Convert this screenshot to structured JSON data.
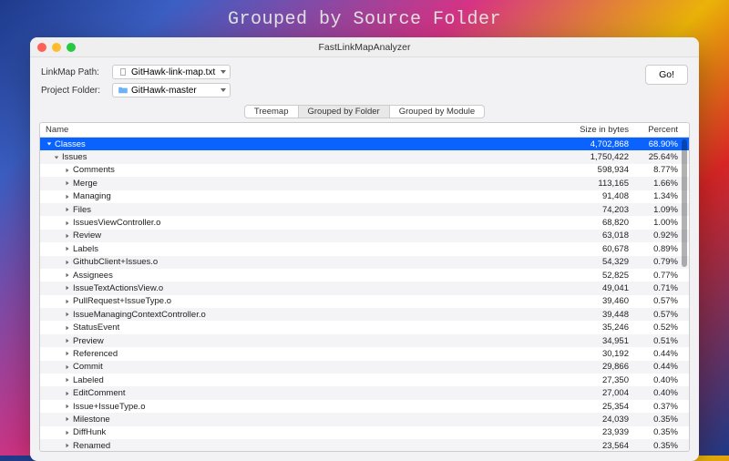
{
  "page_heading": "Grouped by Source Folder",
  "window": {
    "title": "FastLinkMapAnalyzer"
  },
  "toolbar": {
    "linkmap_label": "LinkMap Path:",
    "linkmap_value": "GitHawk-link-map.txt",
    "project_label": "Project Folder:",
    "project_value": "GitHawk-master",
    "go_label": "Go!"
  },
  "tabs": {
    "treemap": "Treemap",
    "folder": "Grouped by Folder",
    "module": "Grouped by Module"
  },
  "table": {
    "headers": {
      "name": "Name",
      "size": "Size in bytes",
      "percent": "Percent"
    },
    "rows": [
      {
        "name": "Classes",
        "size": "4,702,868",
        "percent": "68.90%",
        "indent": 0,
        "expanded": true,
        "selected": true
      },
      {
        "name": "Issues",
        "size": "1,750,422",
        "percent": "25.64%",
        "indent": 1,
        "expanded": true,
        "selected": false
      },
      {
        "name": "Comments",
        "size": "598,934",
        "percent": "8.77%",
        "indent": 2,
        "expanded": false,
        "selected": false
      },
      {
        "name": "Merge",
        "size": "113,165",
        "percent": "1.66%",
        "indent": 2,
        "expanded": false,
        "selected": false
      },
      {
        "name": "Managing",
        "size": "91,408",
        "percent": "1.34%",
        "indent": 2,
        "expanded": false,
        "selected": false
      },
      {
        "name": "Files",
        "size": "74,203",
        "percent": "1.09%",
        "indent": 2,
        "expanded": false,
        "selected": false
      },
      {
        "name": "IssuesViewController.o",
        "size": "68,820",
        "percent": "1.00%",
        "indent": 2,
        "expanded": false,
        "selected": false
      },
      {
        "name": "Review",
        "size": "63,018",
        "percent": "0.92%",
        "indent": 2,
        "expanded": false,
        "selected": false
      },
      {
        "name": "Labels",
        "size": "60,678",
        "percent": "0.89%",
        "indent": 2,
        "expanded": false,
        "selected": false
      },
      {
        "name": "GithubClient+Issues.o",
        "size": "54,329",
        "percent": "0.79%",
        "indent": 2,
        "expanded": false,
        "selected": false
      },
      {
        "name": "Assignees",
        "size": "52,825",
        "percent": "0.77%",
        "indent": 2,
        "expanded": false,
        "selected": false
      },
      {
        "name": "IssueTextActionsView.o",
        "size": "49,041",
        "percent": "0.71%",
        "indent": 2,
        "expanded": false,
        "selected": false
      },
      {
        "name": "PullRequest+IssueType.o",
        "size": "39,460",
        "percent": "0.57%",
        "indent": 2,
        "expanded": false,
        "selected": false
      },
      {
        "name": "IssueManagingContextController.o",
        "size": "39,448",
        "percent": "0.57%",
        "indent": 2,
        "expanded": false,
        "selected": false
      },
      {
        "name": "StatusEvent",
        "size": "35,246",
        "percent": "0.52%",
        "indent": 2,
        "expanded": false,
        "selected": false
      },
      {
        "name": "Preview",
        "size": "34,951",
        "percent": "0.51%",
        "indent": 2,
        "expanded": false,
        "selected": false
      },
      {
        "name": "Referenced",
        "size": "30,192",
        "percent": "0.44%",
        "indent": 2,
        "expanded": false,
        "selected": false
      },
      {
        "name": "Commit",
        "size": "29,866",
        "percent": "0.44%",
        "indent": 2,
        "expanded": false,
        "selected": false
      },
      {
        "name": "Labeled",
        "size": "27,350",
        "percent": "0.40%",
        "indent": 2,
        "expanded": false,
        "selected": false
      },
      {
        "name": "EditComment",
        "size": "27,004",
        "percent": "0.40%",
        "indent": 2,
        "expanded": false,
        "selected": false
      },
      {
        "name": "Issue+IssueType.o",
        "size": "25,354",
        "percent": "0.37%",
        "indent": 2,
        "expanded": false,
        "selected": false
      },
      {
        "name": "Milestone",
        "size": "24,039",
        "percent": "0.35%",
        "indent": 2,
        "expanded": false,
        "selected": false
      },
      {
        "name": "DiffHunk",
        "size": "23,939",
        "percent": "0.35%",
        "indent": 2,
        "expanded": false,
        "selected": false
      },
      {
        "name": "Renamed",
        "size": "23,564",
        "percent": "0.35%",
        "indent": 2,
        "expanded": false,
        "selected": false
      }
    ]
  }
}
